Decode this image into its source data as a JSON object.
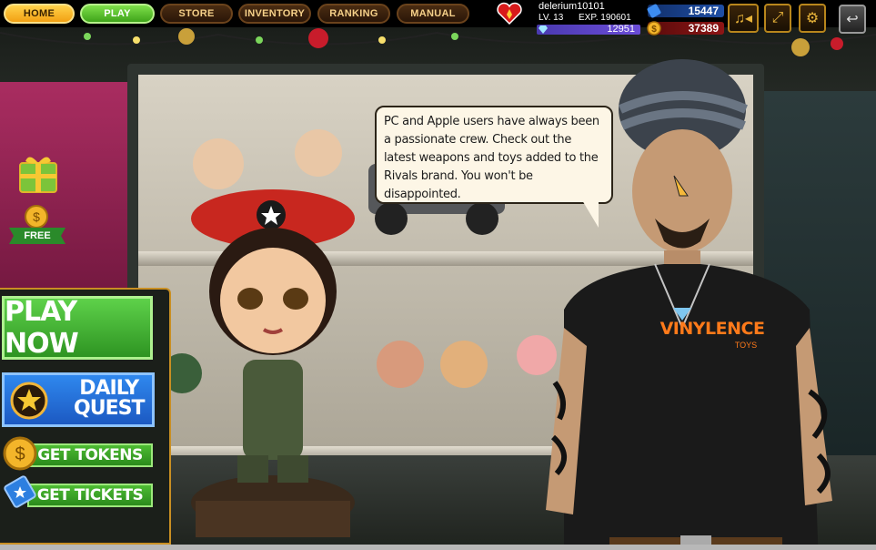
{
  "nav": {
    "tabs": [
      "HOME",
      "PLAY",
      "STORE",
      "INVENTORY",
      "RANKING",
      "MANUAL"
    ],
    "active": "HOME"
  },
  "profile": {
    "username": "delerium10101",
    "level": "LV. 13",
    "exp": "EXP. 190601",
    "gems": "12951"
  },
  "currency": {
    "tickets": "15447",
    "tokens": "37389"
  },
  "toolbar": {
    "icons": [
      "music-sound-icon",
      "fullscreen-icon",
      "settings-gear-icon",
      "back-arrow-icon"
    ]
  },
  "left_menu": {
    "free_label": "FREE",
    "play_now": "PLAY NOW",
    "daily_quest_line1": "DAILY",
    "daily_quest_line2": "QUEST",
    "get_tokens": "GET TOKENS",
    "get_tickets": "GET TICKETS"
  },
  "npc": {
    "speech": "PC and Apple users have always been a passionate crew. Check out the latest weapons and toys added to the Rivals brand. You won't be disappointed.",
    "shirt_brand": "VINYLENCE",
    "shirt_sub": "TOYS"
  },
  "colors": {
    "home_tab": "#f2a013",
    "play_tab": "#3fa41a",
    "play_now": "#2e9422",
    "daily_quest": "#1c59c2",
    "panel_border": "#c98f23"
  }
}
